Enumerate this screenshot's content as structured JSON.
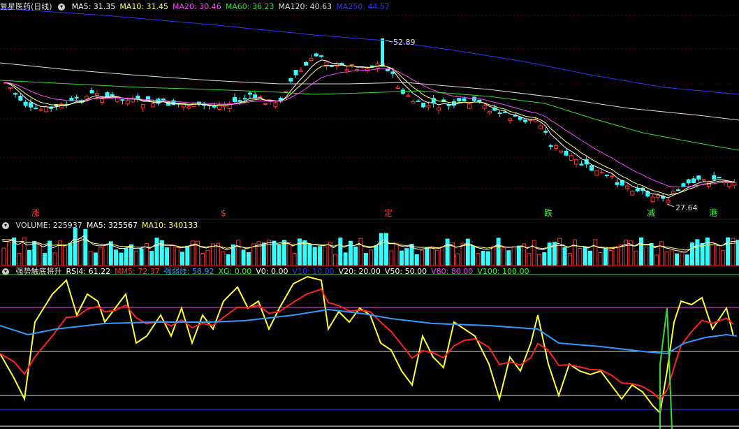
{
  "main": {
    "title": "复星医药(日线)",
    "ma": [
      {
        "label": "MA5: 31.35",
        "color": "#ffffff"
      },
      {
        "label": "MA10: 31.45",
        "color": "#ffff66"
      },
      {
        "label": "MA20: 30.46",
        "color": "#ff44ff"
      },
      {
        "label": "MA60: 36.23",
        "color": "#33dd33"
      },
      {
        "label": "MA120: 40.63",
        "color": "#dddddd"
      },
      {
        "label": "MA250: 44.57",
        "color": "#3333ff"
      }
    ],
    "high_label": "52.89",
    "low_label": "27.64",
    "signals": [
      {
        "text": "涨",
        "color": "#ff3333"
      },
      {
        "text": "$",
        "color": "#ff3333"
      },
      {
        "text": "定",
        "color": "#ff3333"
      },
      {
        "text": "跌",
        "color": "#33ff33"
      },
      {
        "text": "减",
        "color": "#33ff33"
      },
      {
        "text": "港",
        "color": "#33ff33"
      }
    ]
  },
  "volume": {
    "items": [
      {
        "label": "VOLUME: 225937",
        "color": "#dddddd"
      },
      {
        "label": "MA5: 325567",
        "color": "#ffffff"
      },
      {
        "label": "MA10: 340133",
        "color": "#ffff66"
      }
    ]
  },
  "indicator": {
    "items": [
      {
        "label": "强势触底将升",
        "color": "#dddddd"
      },
      {
        "label": "RSI4: 61.22",
        "color": "#ffffff"
      },
      {
        "label": "MM5: 72.37",
        "color": "#ff3333"
      },
      {
        "label": "强弱线: 58.92",
        "color": "#3399ff"
      },
      {
        "label": "XG: 0.00",
        "color": "#33ff33"
      },
      {
        "label": "V0: 0.00",
        "color": "#ffffff"
      },
      {
        "label": "V10: 10.00",
        "color": "#3333ff"
      },
      {
        "label": "V20: 20.00",
        "color": "#ffffff"
      },
      {
        "label": "V50: 50.00",
        "color": "#ffffff"
      },
      {
        "label": "V80: 80.00",
        "color": "#ff44ff"
      },
      {
        "label": "V100: 100.00",
        "color": "#33ff33"
      }
    ]
  },
  "colors": {
    "up": "#ff3333",
    "down": "#33ffff",
    "grid": "#8b0000"
  }
}
